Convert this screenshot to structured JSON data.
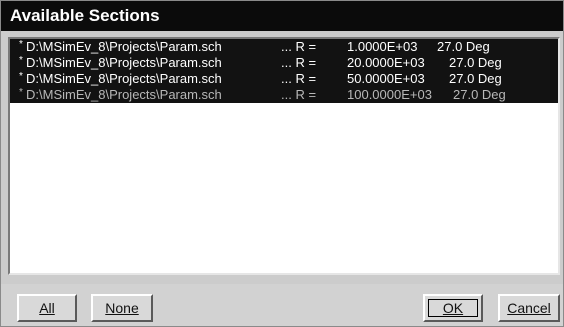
{
  "dialog": {
    "title": "Available Sections"
  },
  "list": {
    "items": [
      {
        "marker": "*",
        "path": "D:\\MSimEv_8\\Projects\\Param.sch",
        "equals": "... R =",
        "value": "1.0000E+03",
        "angle": "27.0 Deg"
      },
      {
        "marker": "*",
        "path": "D:\\MSimEv_8\\Projects\\Param.sch",
        "equals": "... R =",
        "value": "20.0000E+03",
        "angle": "27.0 Deg"
      },
      {
        "marker": "*",
        "path": "D:\\MSimEv_8\\Projects\\Param.sch",
        "equals": "... R =",
        "value": "50.0000E+03",
        "angle": "27.0 Deg"
      },
      {
        "marker": "*",
        "path": "D:\\MSimEv_8\\Projects\\Param.sch",
        "equals": "... R =",
        "value": "100.0000E+03",
        "angle": "27.0 Deg"
      }
    ]
  },
  "buttons": {
    "all": "All",
    "none": "None",
    "ok": "OK",
    "cancel": "Cancel"
  },
  "colors": {
    "title_bar": "#0b0b0b",
    "selection": "#121212",
    "list_background": "#ffffff",
    "dialog_face": "#cccccc"
  }
}
